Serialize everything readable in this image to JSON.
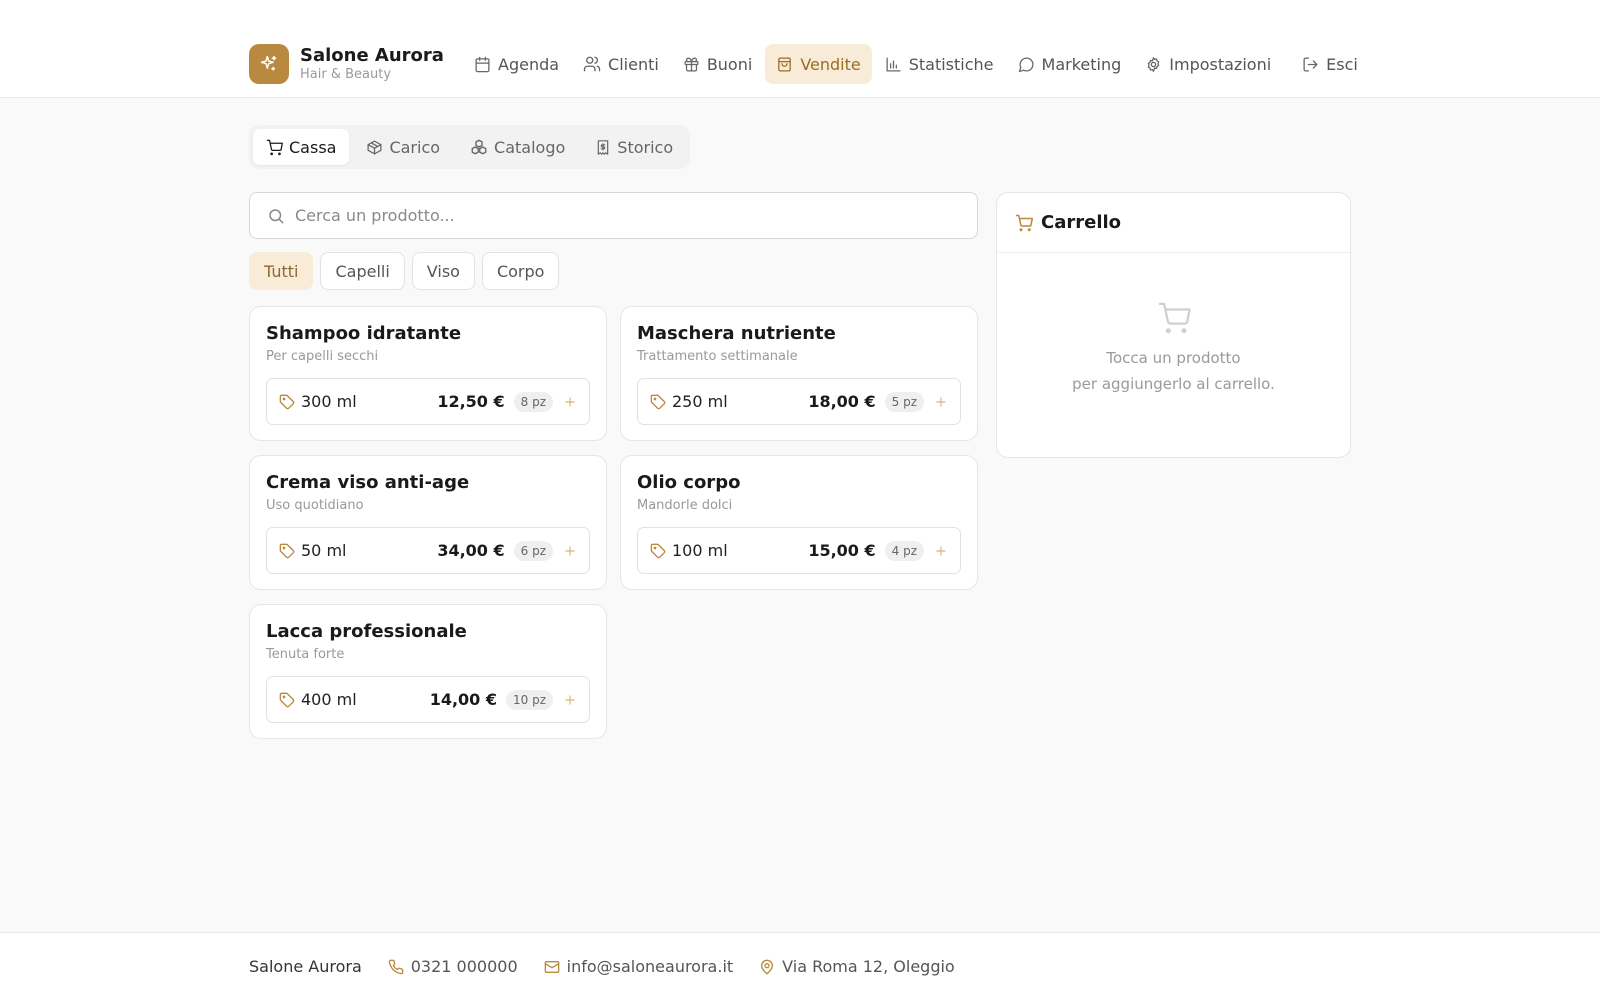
{
  "colors": {
    "accent": "#b8893e",
    "accent_bg": "#f8ecd9",
    "accent_text": "#9a6c1f"
  },
  "brand": {
    "name": "Salone Aurora",
    "subtitle": "Hair & Beauty",
    "icon": "sparkles-icon"
  },
  "nav": {
    "agenda": "Agenda",
    "clienti": "Clienti",
    "buoni": "Buoni",
    "vendite": "Vendite",
    "statistiche": "Statistiche",
    "marketing": "Marketing",
    "impostazioni": "Impostazioni",
    "esci": "Esci"
  },
  "subtabs": {
    "cassa": "Cassa",
    "carico": "Carico",
    "catalogo": "Catalogo",
    "storico": "Storico"
  },
  "search": {
    "placeholder": "Cerca un prodotto...",
    "value": ""
  },
  "filters": {
    "tutti": "Tutti",
    "capelli": "Capelli",
    "viso": "Viso",
    "corpo": "Corpo",
    "selected": "Tutti"
  },
  "products": [
    {
      "name": "Shampoo idratante",
      "description": "Per capelli secchi",
      "size": "300 ml",
      "price": "12,50 €",
      "stock": "8 pz"
    },
    {
      "name": "Maschera nutriente",
      "description": "Trattamento settimanale",
      "size": "250 ml",
      "price": "18,00 €",
      "stock": "5 pz"
    },
    {
      "name": "Crema viso anti-age",
      "description": "Uso quotidiano",
      "size": "50 ml",
      "price": "34,00 €",
      "stock": "6 pz"
    },
    {
      "name": "Olio corpo",
      "description": "Mandorle dolci",
      "size": "100 ml",
      "price": "15,00 €",
      "stock": "4 pz"
    },
    {
      "name": "Lacca professionale",
      "description": "Tenuta forte",
      "size": "400 ml",
      "price": "14,00 €",
      "stock": "10 pz"
    }
  ],
  "cart": {
    "title": "Carrello",
    "empty_line1": "Tocca un prodotto",
    "empty_line2": "per aggiungerlo al carrello."
  },
  "footer": {
    "name": "Salone Aurora",
    "phone": "0321 000000",
    "email": "info@saloneaurora.it",
    "address": "Via Roma 12, Oleggio"
  }
}
